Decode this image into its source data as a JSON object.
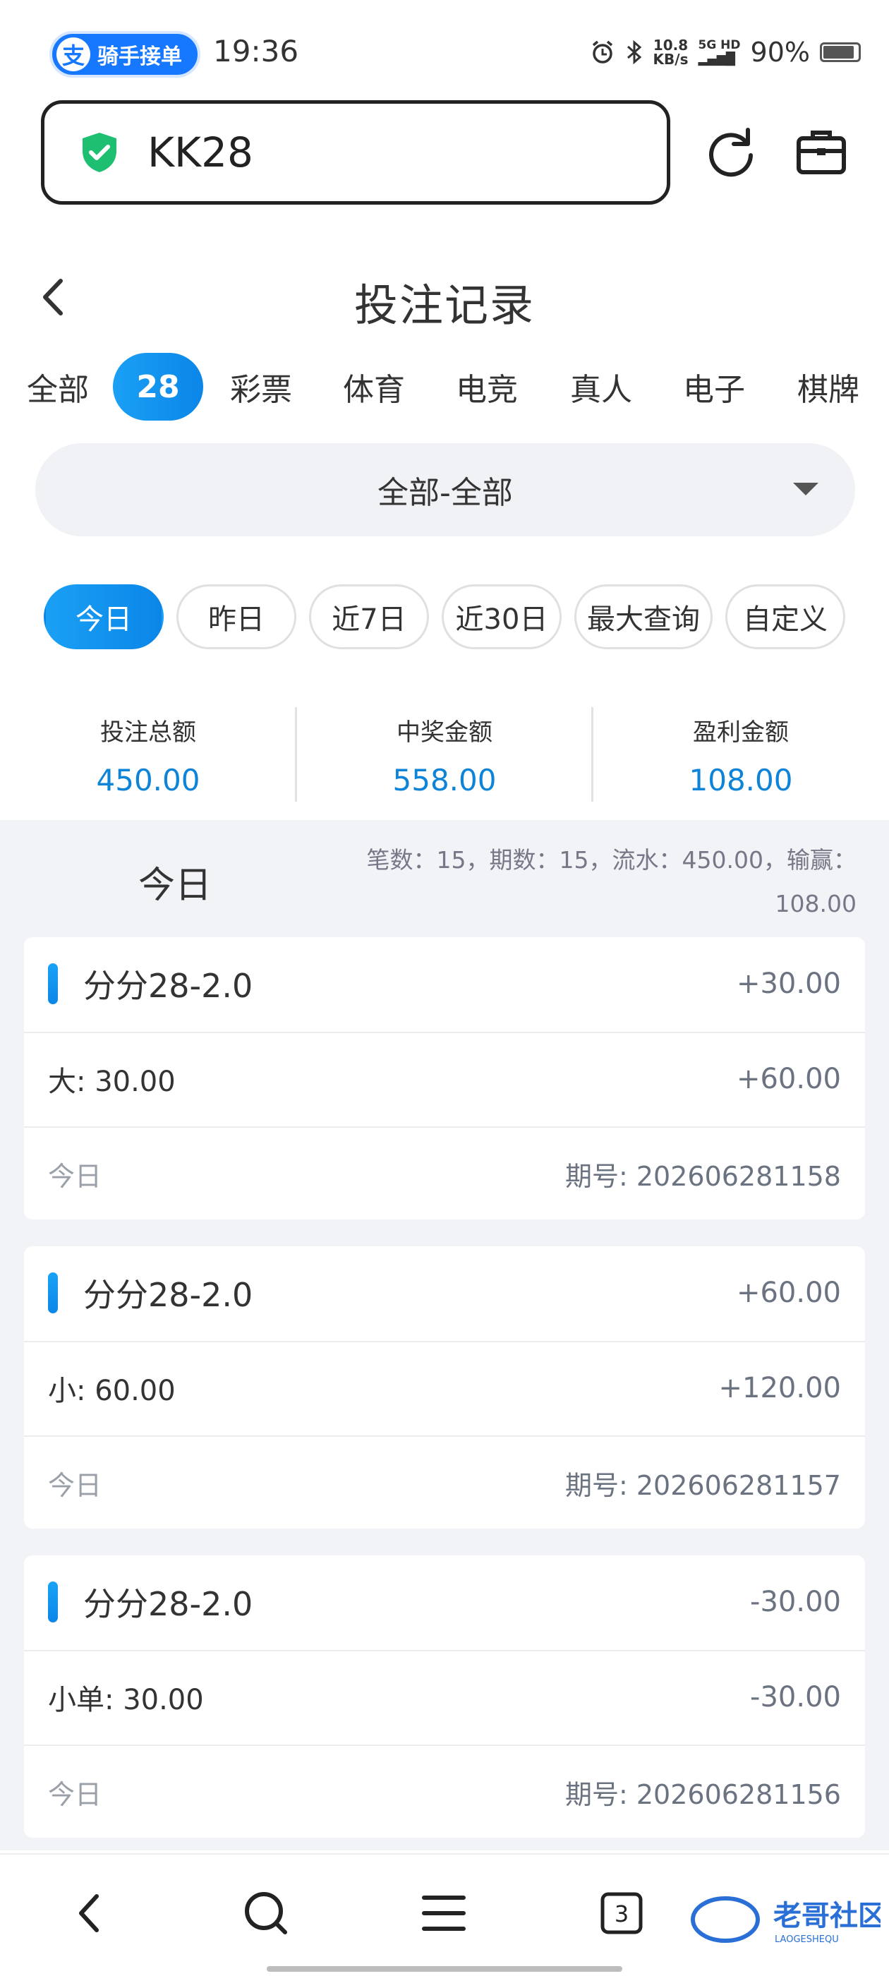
{
  "status_bar": {
    "alipay_logo": "支",
    "alipay_label": "骑手接单",
    "time": "19:36",
    "net_speed_value": "10.8",
    "net_speed_unit": "KB/s",
    "signal_label_top": "5G HD",
    "signal_label_bottom": "▂▄▆█",
    "battery_percent": "90%",
    "battery_level": 0.9
  },
  "browser": {
    "url": "KK28"
  },
  "page": {
    "title": "投注记录"
  },
  "category_tabs": [
    {
      "label": "全部",
      "active": false
    },
    {
      "label": "28",
      "active": true
    },
    {
      "label": "彩票",
      "active": false
    },
    {
      "label": "体育",
      "active": false
    },
    {
      "label": "电竞",
      "active": false
    },
    {
      "label": "真人",
      "active": false
    },
    {
      "label": "电子",
      "active": false
    },
    {
      "label": "棋牌",
      "active": false
    }
  ],
  "filter": {
    "value": "全部-全部"
  },
  "date_chips": [
    {
      "label": "今日",
      "active": true
    },
    {
      "label": "昨日",
      "active": false
    },
    {
      "label": "近7日",
      "active": false
    },
    {
      "label": "近30日",
      "active": false
    },
    {
      "label": "最大查询",
      "active": false
    },
    {
      "label": "自定义",
      "active": false
    }
  ],
  "summary": [
    {
      "label": "投注总额",
      "value": "450.00"
    },
    {
      "label": "中奖金额",
      "value": "558.00"
    },
    {
      "label": "盈利金额",
      "value": "108.00"
    }
  ],
  "day_group": {
    "label": "今日",
    "stats_line1": "笔数：15，期数：15，流水：450.00，输赢：",
    "stats_line2": "108.00"
  },
  "records": [
    {
      "game": "分分28-2.0",
      "profit": "+30.00",
      "bet": "大:   30.00",
      "payout": "+60.00",
      "date": "今日",
      "period": "期号: 202606281158"
    },
    {
      "game": "分分28-2.0",
      "profit": "+60.00",
      "bet": "小:   60.00",
      "payout": "+120.00",
      "date": "今日",
      "period": "期号: 202606281157"
    },
    {
      "game": "分分28-2.0",
      "profit": "-30.00",
      "bet": "小单:   30.00",
      "payout": "-30.00",
      "date": "今日",
      "period": "期号: 202606281156"
    }
  ],
  "bottom_nav": {
    "tabs_count": "3"
  },
  "watermark": {
    "text": "老哥社区",
    "subtext": "LAOGESHEQU"
  },
  "colors": {
    "accent": "#0d84d8",
    "active_gradient_start": "#1aa0f5",
    "active_gradient_end": "#0b86e8",
    "alipay_blue": "#1677ff",
    "shield_green": "#1fbf72"
  }
}
